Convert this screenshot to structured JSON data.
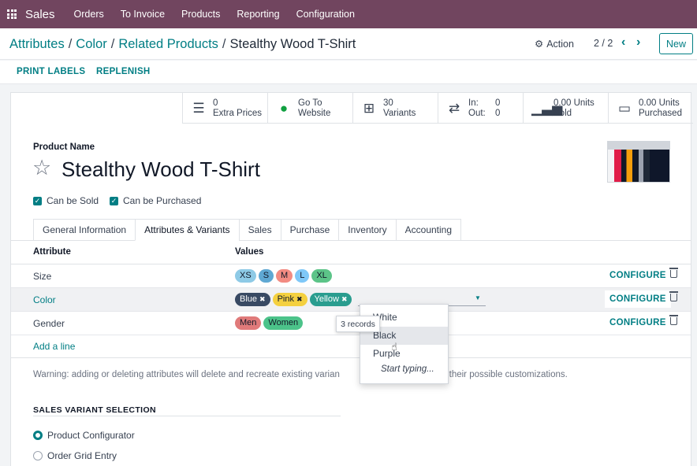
{
  "navbar": {
    "app_name": "Sales",
    "menu": [
      "Orders",
      "To Invoice",
      "Products",
      "Reporting",
      "Configuration"
    ]
  },
  "breadcrumb": [
    "Attributes",
    "Color",
    "Related Products",
    "Stealthy Wood T-Shirt"
  ],
  "control": {
    "action_label": "Action",
    "pager": "2 / 2",
    "new_label": "New"
  },
  "statusbar": {
    "print_labels": "PRINT LABELS",
    "replenish": "REPLENISH"
  },
  "smart_buttons": [
    {
      "icon": "list-icon",
      "value": "0",
      "label": "Extra Prices"
    },
    {
      "icon": "globe-icon",
      "value": "Go To",
      "label": "Website"
    },
    {
      "icon": "sitemap-icon",
      "value": "30",
      "label": "Variants"
    },
    {
      "icon": "exchange-icon",
      "in_label": "In:",
      "in_value": "0",
      "out_label": "Out:",
      "out_value": "0"
    },
    {
      "icon": "bar-chart-icon",
      "value": "0.00 Units",
      "label": "Sold"
    },
    {
      "icon": "credit-card-icon",
      "value": "0.00 Units",
      "label": "Purchased"
    }
  ],
  "product": {
    "name_label": "Product Name",
    "name": "Stealthy Wood T-Shirt",
    "can_be_sold": "Can be Sold",
    "can_be_purchased": "Can be Purchased"
  },
  "tabs": [
    "General Information",
    "Attributes & Variants",
    "Sales",
    "Purchase",
    "Inventory",
    "Accounting"
  ],
  "table": {
    "header_attribute": "Attribute",
    "header_values": "Values",
    "configure_label": "CONFIGURE",
    "rows": [
      {
        "attribute": "Size",
        "values": [
          "XS",
          "S",
          "M",
          "L",
          "XL"
        ],
        "colors": [
          "#8ecae6",
          "#5fa8d3",
          "#f28b82",
          "#7fc8f8",
          "#5cc488"
        ]
      },
      {
        "attribute": "Color",
        "values": [
          "Blue",
          "Pink",
          "Yellow"
        ],
        "colors": [
          "#394a63",
          "#f4d03f",
          "#2a9d8f"
        ]
      },
      {
        "attribute": "Gender",
        "values": [
          "Men",
          "Women"
        ],
        "colors": [
          "#e07a7a",
          "#4cc38a"
        ]
      }
    ],
    "add_line": "Add a line"
  },
  "dropdown": {
    "options": [
      "White",
      "Black",
      "Purple"
    ],
    "highlighted": "Black",
    "start_typing": "Start typing...",
    "tooltip": "3 records"
  },
  "warning": "Warning: adding or deleting attributes will delete and recreate existing varian",
  "warning_tail": "s of their possible customizations.",
  "sales_variant": {
    "title": "SALES VARIANT SELECTION",
    "options": [
      "Product Configurator",
      "Order Grid Entry"
    ],
    "selected": "Product Configurator"
  }
}
